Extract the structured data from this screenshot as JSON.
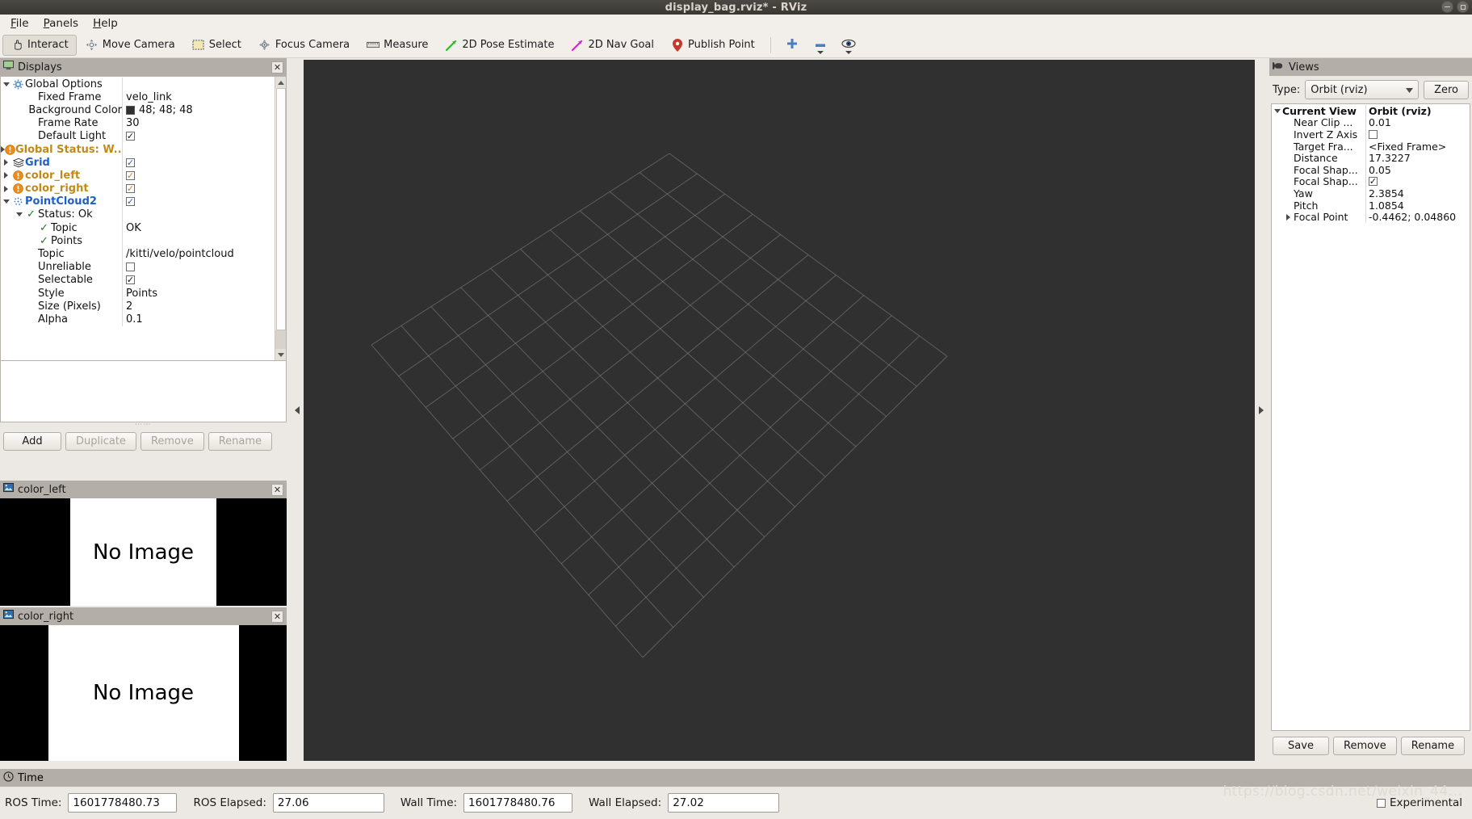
{
  "window": {
    "title": "display_bag.rviz* - RViz",
    "controls": [
      "minimize",
      "maximize"
    ]
  },
  "menubar": {
    "items": [
      "File",
      "Panels",
      "Help"
    ]
  },
  "toolbar": {
    "items": [
      {
        "label": "Interact",
        "icon": "hand-icon",
        "active": true
      },
      {
        "label": "Move Camera",
        "icon": "move-camera-icon",
        "active": false
      },
      {
        "label": "Select",
        "icon": "select-rect-icon",
        "active": false
      },
      {
        "label": "Focus Camera",
        "icon": "focus-camera-icon",
        "active": false
      },
      {
        "label": "Measure",
        "icon": "ruler-icon",
        "active": false
      },
      {
        "label": "2D Pose Estimate",
        "icon": "green-arrow-icon",
        "active": false
      },
      {
        "label": "2D Nav Goal",
        "icon": "magenta-arrow-icon",
        "active": false
      },
      {
        "label": "Publish Point",
        "icon": "map-pin-icon",
        "active": false
      }
    ],
    "extra_icons": [
      "plus-icon",
      "minus-icon",
      "eye-icon"
    ]
  },
  "displays": {
    "header": "Displays",
    "tree": [
      {
        "name": "Global Options",
        "value": "",
        "indent": 0,
        "twisty": "down",
        "icon": "gear-icon",
        "style": "plain"
      },
      {
        "name": "Fixed Frame",
        "value": "velo_link",
        "indent": 1,
        "twisty": "none",
        "icon": "none",
        "style": "plain"
      },
      {
        "name": "Background Color",
        "value": "48; 48; 48",
        "indent": 1,
        "twisty": "none",
        "icon": "none",
        "style": "plain",
        "swatch": "#303030"
      },
      {
        "name": "Frame Rate",
        "value": "30",
        "indent": 1,
        "twisty": "none",
        "icon": "none",
        "style": "plain"
      },
      {
        "name": "Default Light",
        "value": "",
        "indent": 1,
        "twisty": "none",
        "icon": "none",
        "style": "plain",
        "checkbox": "on"
      },
      {
        "name": "Global Status: W...",
        "value": "",
        "indent": 0,
        "twisty": "right",
        "icon": "warning-icon",
        "style": "orange"
      },
      {
        "name": "Grid",
        "value": "",
        "indent": 0,
        "twisty": "right",
        "icon": "grid-icon",
        "style": "blue",
        "checkbox": "onblue"
      },
      {
        "name": "color_left",
        "value": "",
        "indent": 0,
        "twisty": "right",
        "icon": "warning-icon",
        "style": "orange",
        "checkbox": "onorange"
      },
      {
        "name": "color_right",
        "value": "",
        "indent": 0,
        "twisty": "right",
        "icon": "warning-icon",
        "style": "orange",
        "checkbox": "onorange"
      },
      {
        "name": "PointCloud2",
        "value": "",
        "indent": 0,
        "twisty": "down",
        "icon": "pointcloud-icon",
        "style": "blue",
        "checkbox": "onblue"
      },
      {
        "name": "Status: Ok",
        "value": "",
        "indent": 1,
        "twisty": "down",
        "icon": "check-icon",
        "style": "plain"
      },
      {
        "name": "Topic",
        "value": "OK",
        "indent": 2,
        "twisty": "none",
        "icon": "check-icon",
        "style": "plain"
      },
      {
        "name": "Points",
        "value": "",
        "indent": 2,
        "twisty": "none",
        "icon": "check-icon",
        "style": "plain"
      },
      {
        "name": "Topic",
        "value": "/kitti/velo/pointcloud",
        "indent": 1,
        "twisty": "none",
        "icon": "none",
        "style": "plain"
      },
      {
        "name": "Unreliable",
        "value": "",
        "indent": 1,
        "twisty": "none",
        "icon": "none",
        "style": "plain",
        "checkbox": "off"
      },
      {
        "name": "Selectable",
        "value": "",
        "indent": 1,
        "twisty": "none",
        "icon": "none",
        "style": "plain",
        "checkbox": "on"
      },
      {
        "name": "Style",
        "value": "Points",
        "indent": 1,
        "twisty": "none",
        "icon": "none",
        "style": "plain"
      },
      {
        "name": "Size (Pixels)",
        "value": "2",
        "indent": 1,
        "twisty": "none",
        "icon": "none",
        "style": "plain"
      },
      {
        "name": "Alpha",
        "value": "0.1",
        "indent": 1,
        "twisty": "none",
        "icon": "none",
        "style": "plain"
      }
    ],
    "buttons": [
      {
        "label": "Add",
        "enabled": true
      },
      {
        "label": "Duplicate",
        "enabled": false
      },
      {
        "label": "Remove",
        "enabled": false
      },
      {
        "label": "Rename",
        "enabled": false
      }
    ]
  },
  "image_panels": [
    {
      "header": "color_left",
      "message": "No Image"
    },
    {
      "header": "color_right",
      "message": "No Image"
    }
  ],
  "views": {
    "header": "Views",
    "type_label": "Type:",
    "type_value": "Orbit (rviz)",
    "zero_button": "Zero",
    "tree": [
      {
        "name": "Current View",
        "value": "Orbit (rviz)",
        "indent": 0,
        "twisty": "down",
        "bold": true
      },
      {
        "name": "Near Clip ...",
        "value": "0.01",
        "indent": 1,
        "twisty": "none",
        "bold": false
      },
      {
        "name": "Invert Z Axis",
        "value": "",
        "indent": 1,
        "twisty": "none",
        "bold": false,
        "checkbox": "off"
      },
      {
        "name": "Target Fra...",
        "value": "<Fixed Frame>",
        "indent": 1,
        "twisty": "none",
        "bold": false
      },
      {
        "name": "Distance",
        "value": "17.3227",
        "indent": 1,
        "twisty": "none",
        "bold": false
      },
      {
        "name": "Focal Shap...",
        "value": "0.05",
        "indent": 1,
        "twisty": "none",
        "bold": false
      },
      {
        "name": "Focal Shap...",
        "value": "",
        "indent": 1,
        "twisty": "none",
        "bold": false,
        "checkbox": "on"
      },
      {
        "name": "Yaw",
        "value": "2.3854",
        "indent": 1,
        "twisty": "none",
        "bold": false
      },
      {
        "name": "Pitch",
        "value": "1.0854",
        "indent": 1,
        "twisty": "none",
        "bold": false
      },
      {
        "name": "Focal Point",
        "value": "-0.4462; 0.04860",
        "indent": 1,
        "twisty": "right",
        "bold": false
      }
    ],
    "buttons": [
      {
        "label": "Save"
      },
      {
        "label": "Remove"
      },
      {
        "label": "Rename"
      }
    ]
  },
  "time": {
    "header": "Time",
    "fields": [
      {
        "label": "ROS Time:",
        "value": "1601778480.73",
        "width": "long"
      },
      {
        "label": "ROS Elapsed:",
        "value": "27.06",
        "width": "short"
      },
      {
        "label": "Wall Time:",
        "value": "1601778480.76",
        "width": "long"
      },
      {
        "label": "Wall Elapsed:",
        "value": "27.02",
        "width": "short"
      }
    ],
    "experimental_label": "Experimental",
    "experimental_checked": false
  },
  "watermark": "https://blog.csdn.net/weixin_44...",
  "render": {
    "background_color": "#303030",
    "grid_line_color": "#8c8c8c",
    "grid_cells": 10
  },
  "colors": {
    "panel_bg": "#ece9e4",
    "panel_header": "#b3afa8",
    "titlebar": "#3a3833",
    "accent_blue": "#2060c0",
    "accent_orange": "#c08a1a",
    "status_green": "#1b7a1b",
    "view_bg": "#303030"
  }
}
